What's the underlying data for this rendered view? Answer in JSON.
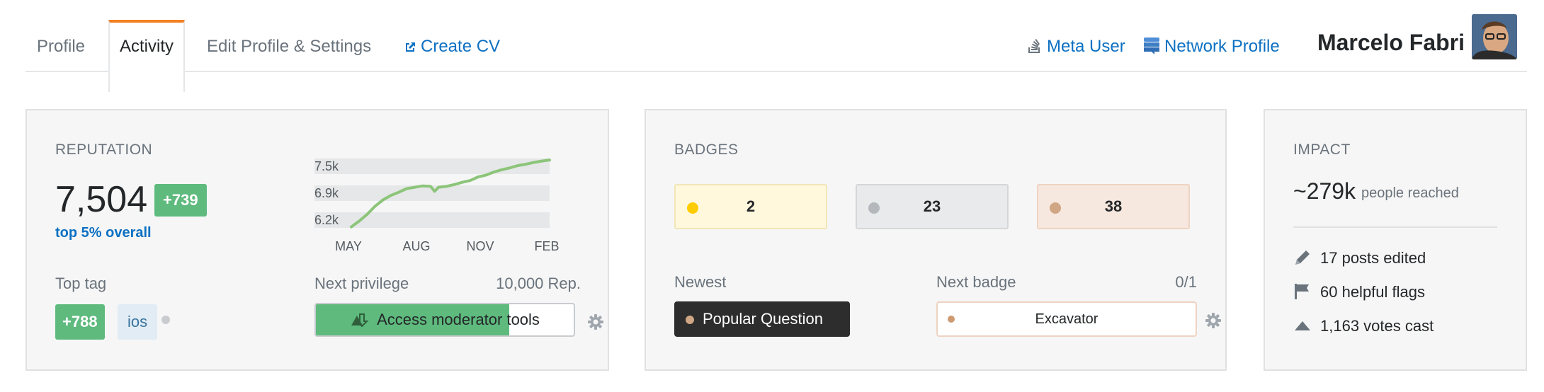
{
  "tabs": {
    "profile": "Profile",
    "activity": "Activity",
    "edit": "Edit Profile & Settings",
    "cv": "Create CV"
  },
  "header": {
    "meta_user": "Meta User",
    "network_profile": "Network Profile",
    "user_name": "Marcelo Fabri"
  },
  "reputation": {
    "title": "REPUTATION",
    "value": "7,504",
    "change": "+739",
    "rank": "top 5% overall",
    "top_tag_label": "Top tag",
    "top_tag_score": "+788",
    "top_tag_name": "ios",
    "next_privilege_label": "Next privilege",
    "next_privilege_rep": "10,000 Rep.",
    "next_privilege_name": "Access moderator tools",
    "next_privilege_progress": 0.75
  },
  "chart_data": {
    "type": "line",
    "y_tick_labels": [
      "7.5k",
      "6.9k",
      "6.2k"
    ],
    "x_tick_labels": [
      "MAY",
      "AUG",
      "NOV",
      "FEB"
    ],
    "ylim": [
      6000,
      7600
    ],
    "series": [
      {
        "color": "#8cc57a",
        "x": [
          0,
          2,
          4,
          6,
          8,
          10,
          12,
          14,
          16,
          18,
          20,
          21,
          22,
          24,
          26,
          28,
          30,
          32,
          34,
          36,
          38,
          40,
          42,
          44,
          46,
          48,
          50
        ],
        "values": [
          6020,
          6150,
          6300,
          6480,
          6620,
          6720,
          6790,
          6870,
          6900,
          6930,
          6920,
          6810,
          6900,
          6920,
          6960,
          7010,
          7050,
          7130,
          7170,
          7240,
          7290,
          7330,
          7380,
          7410,
          7450,
          7480,
          7504
        ]
      }
    ]
  },
  "badges": {
    "title": "BADGES",
    "gold": "2",
    "silver": "23",
    "bronze": "38",
    "gold_color": "#ffcc01",
    "silver_color": "#b4b8bc",
    "bronze_color": "#d1a684",
    "newest_label": "Newest",
    "newest_badge": "Popular Question",
    "next_badge_label": "Next badge",
    "next_badge_progress": "0/1",
    "next_badge_name": "Excavator"
  },
  "impact": {
    "title": "IMPACT",
    "value": "~279k",
    "value_label": "people reached",
    "posts_edited": "17 posts edited",
    "helpful_flags": "60 helpful flags",
    "votes_cast": "1,163 votes cast"
  }
}
